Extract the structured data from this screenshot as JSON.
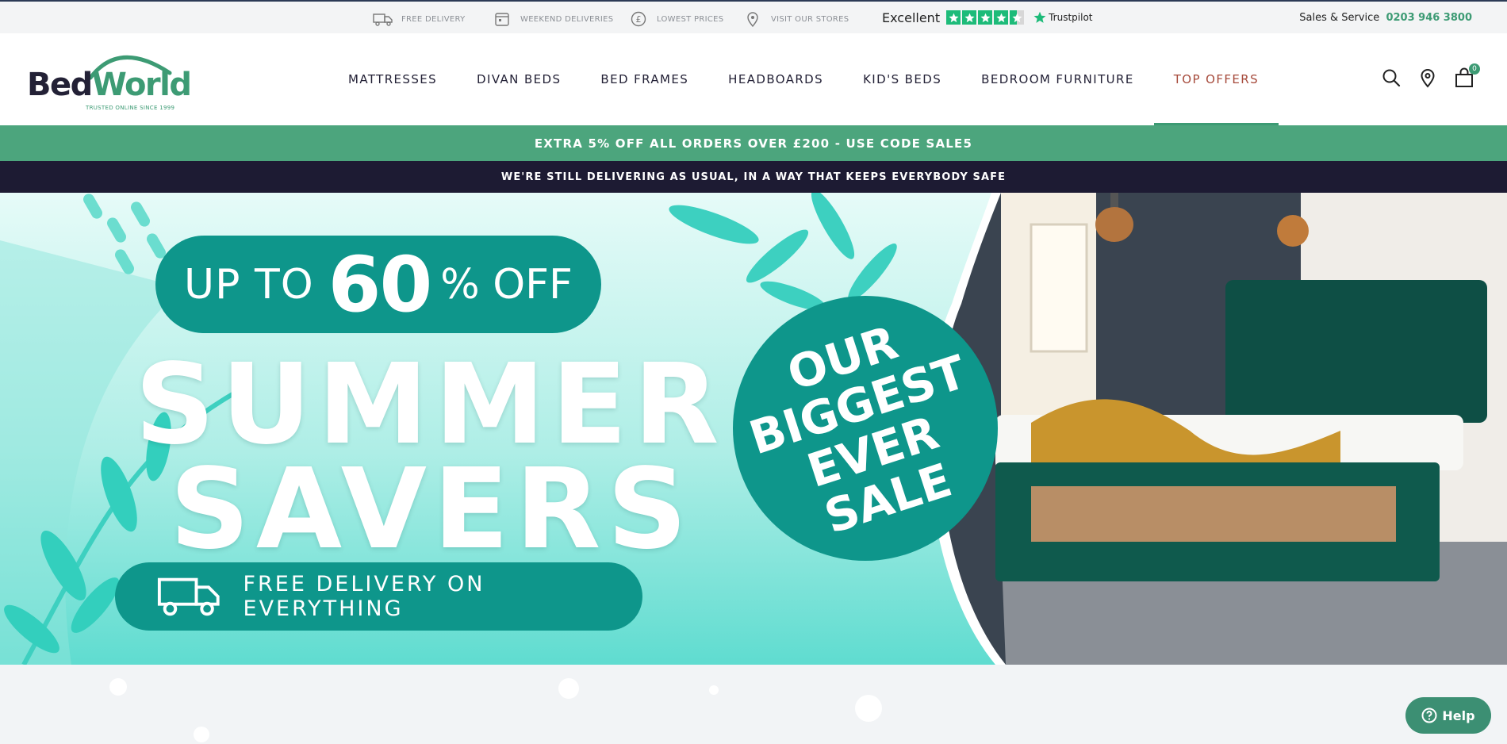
{
  "topbar": {
    "usps": [
      {
        "label": "FREE DELIVERY",
        "icon": "truck-icon"
      },
      {
        "label": "WEEKEND DELIVERIES",
        "icon": "calendar-icon"
      },
      {
        "label": "LOWEST PRICES",
        "icon": "pound-icon"
      },
      {
        "label": "VISIT OUR STORES",
        "icon": "location-pin-icon"
      }
    ],
    "trustpilot": {
      "rating_text": "Excellent",
      "stars": 4.5,
      "brand": "Trustpilot"
    },
    "sales": {
      "label": "Sales & Service",
      "phone": "0203 946 3800"
    }
  },
  "header": {
    "logo": {
      "bed": "Bed",
      "world": "World",
      "tagline": "TRUSTED ONLINE SINCE 1999"
    },
    "nav": [
      {
        "label": "MATTRESSES"
      },
      {
        "label": "DIVAN BEDS"
      },
      {
        "label": "BED FRAMES"
      },
      {
        "label": "HEADBOARDS"
      },
      {
        "label": "KID'S BEDS"
      },
      {
        "label": "BEDROOM FURNITURE"
      },
      {
        "label": "TOP OFFERS",
        "active": true
      }
    ],
    "cart_count": "0"
  },
  "promo_bar": {
    "text": "EXTRA 5% OFF ALL ORDERS OVER £200 - USE CODE SALE5"
  },
  "notice_bar": {
    "text": "WE'RE STILL DELIVERING AS USUAL, IN A WAY THAT KEEPS EVERYBODY SAFE"
  },
  "hero": {
    "up_to": "UP TO",
    "percent": "60",
    "off": "% OFF",
    "line1": "SUMMER",
    "line2": "SAVERS",
    "delivery": "FREE DELIVERY ON EVERYTHING",
    "badge": [
      "OUR",
      "BIGGEST",
      "EVER",
      "SALE"
    ]
  },
  "help_button": {
    "label": "Help"
  },
  "colors": {
    "brand_green": "#3d9b74",
    "navy": "#1d1b33",
    "teal": "#0e968b",
    "active_nav": "#a64a3b"
  }
}
